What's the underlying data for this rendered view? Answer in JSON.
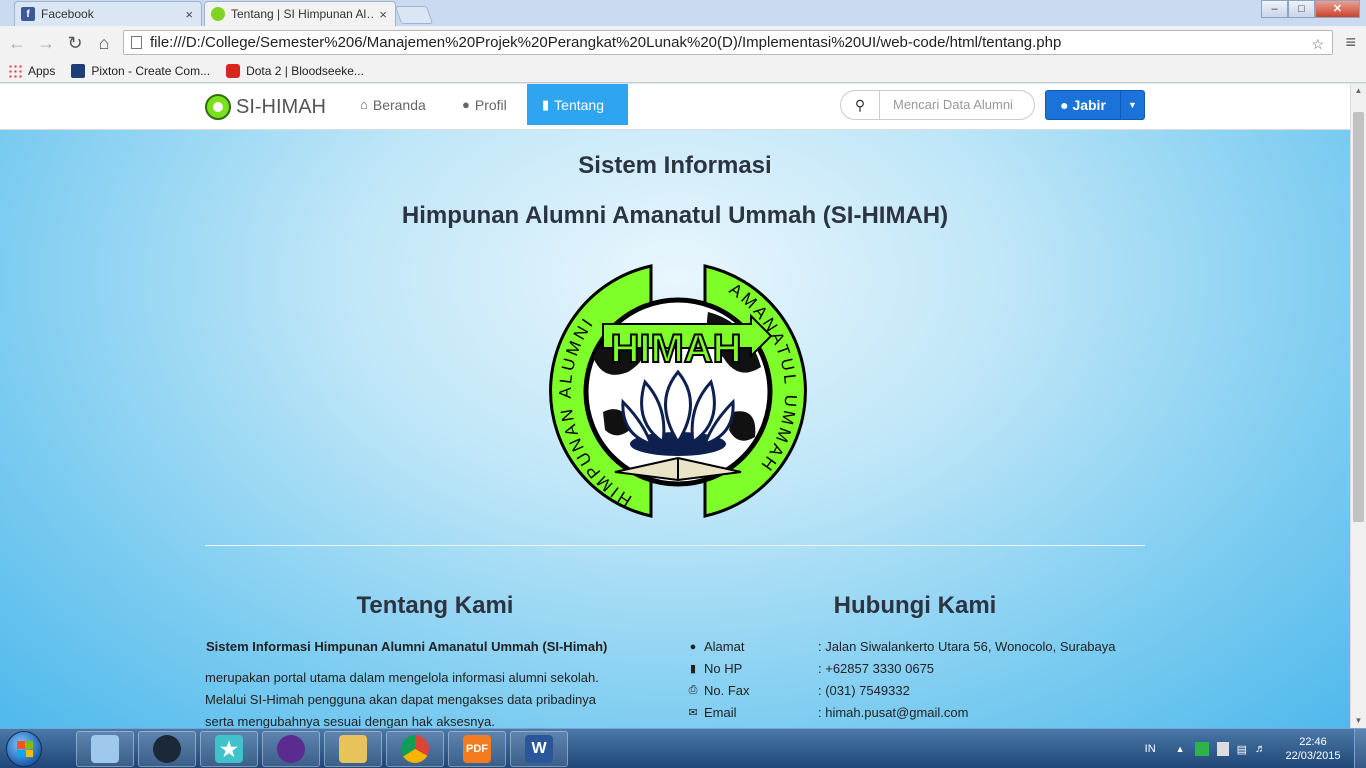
{
  "browser": {
    "tabs": [
      {
        "title": "Facebook",
        "active": false
      },
      {
        "title": "Tentang | SI Himpunan Al…",
        "active": true
      }
    ],
    "close_glyph": "×",
    "window_buttons": [
      "–",
      "□",
      "✕"
    ],
    "url": "file:///D:/College/Semester%206/Manajemen%20Projek%20Perangkat%20Lunak%20(D)/Implementasi%20UI/web-code/html/tentang.php",
    "nav_icons": [
      "back-arrow-icon",
      "forward-arrow-icon",
      "reload-icon",
      "home-icon"
    ],
    "omnibox_right": "☆",
    "menu_glyph": "≡",
    "bookmarks": [
      {
        "label": "Apps",
        "icon": "apps-grid-icon"
      },
      {
        "label": "Pixton - Create Com...",
        "icon": "pixton-icon"
      },
      {
        "label": "Dota 2 | Bloodseeke...",
        "icon": "youtube-icon"
      }
    ]
  },
  "site": {
    "brand": "SI-HIMAH",
    "nav": [
      {
        "label": "Beranda",
        "icon": "home-icon",
        "active": false
      },
      {
        "label": "Profil",
        "icon": "user-icon",
        "active": false
      },
      {
        "label": "Tentang",
        "icon": "bookmark-icon",
        "active": true
      }
    ],
    "search_placeholder": "Mencari Data Alumni",
    "user_button": "Jabir",
    "heading_line1": "Sistem Informasi",
    "heading_line2": "Himpunan Alumni Amanatul Ummah (SI-HIMAH)",
    "logo": {
      "center_text": "HIMAH",
      "ring_left": "HIMPUNAN ALUMNI",
      "ring_right": "AMANATUL UMMAH",
      "accent": "#7fff2a"
    },
    "about": {
      "title": "Tentang Kami",
      "bold_line": "Sistem Informasi Himpunan Alumni Amanatul Ummah (SI-Himah)",
      "text_lines": [
        "merupakan portal utama dalam mengelola informasi alumni sekolah.",
        "Melalui SI-Himah pengguna akan dapat mengakses data pribadinya",
        "serta mengubahnya sesuai dengan hak aksesnya."
      ]
    },
    "contact": {
      "title": "Hubungi Kami",
      "rows": [
        {
          "icon": "map-marker-icon",
          "label": "Alamat",
          "value": ": Jalan Siwalankerto Utara 56, Wonocolo, Surabaya"
        },
        {
          "icon": "bookmark-icon",
          "label": "No HP",
          "value": ": +62857 3330 0675"
        },
        {
          "icon": "print-icon",
          "label": "No. Fax",
          "value": ": (031) 7549332"
        },
        {
          "icon": "envelope-icon",
          "label": "Email",
          "value": ": himah.pusat@gmail.com"
        }
      ]
    }
  },
  "taskbar": {
    "apps": [
      "file-explorer-icon",
      "steam-icon",
      "star-app-icon",
      "purple-app-icon",
      "folder-icon",
      "chrome-icon",
      "foxit-pdf-icon",
      "word-icon"
    ],
    "pdf_label": "PDF",
    "word_label": "W",
    "language": "IN",
    "time": "22:46",
    "date": "22/03/2015"
  },
  "colors": {
    "nav_active": "#2fa4f1",
    "user_button": "#1b72d8",
    "logo_green": "#7fff2a"
  }
}
